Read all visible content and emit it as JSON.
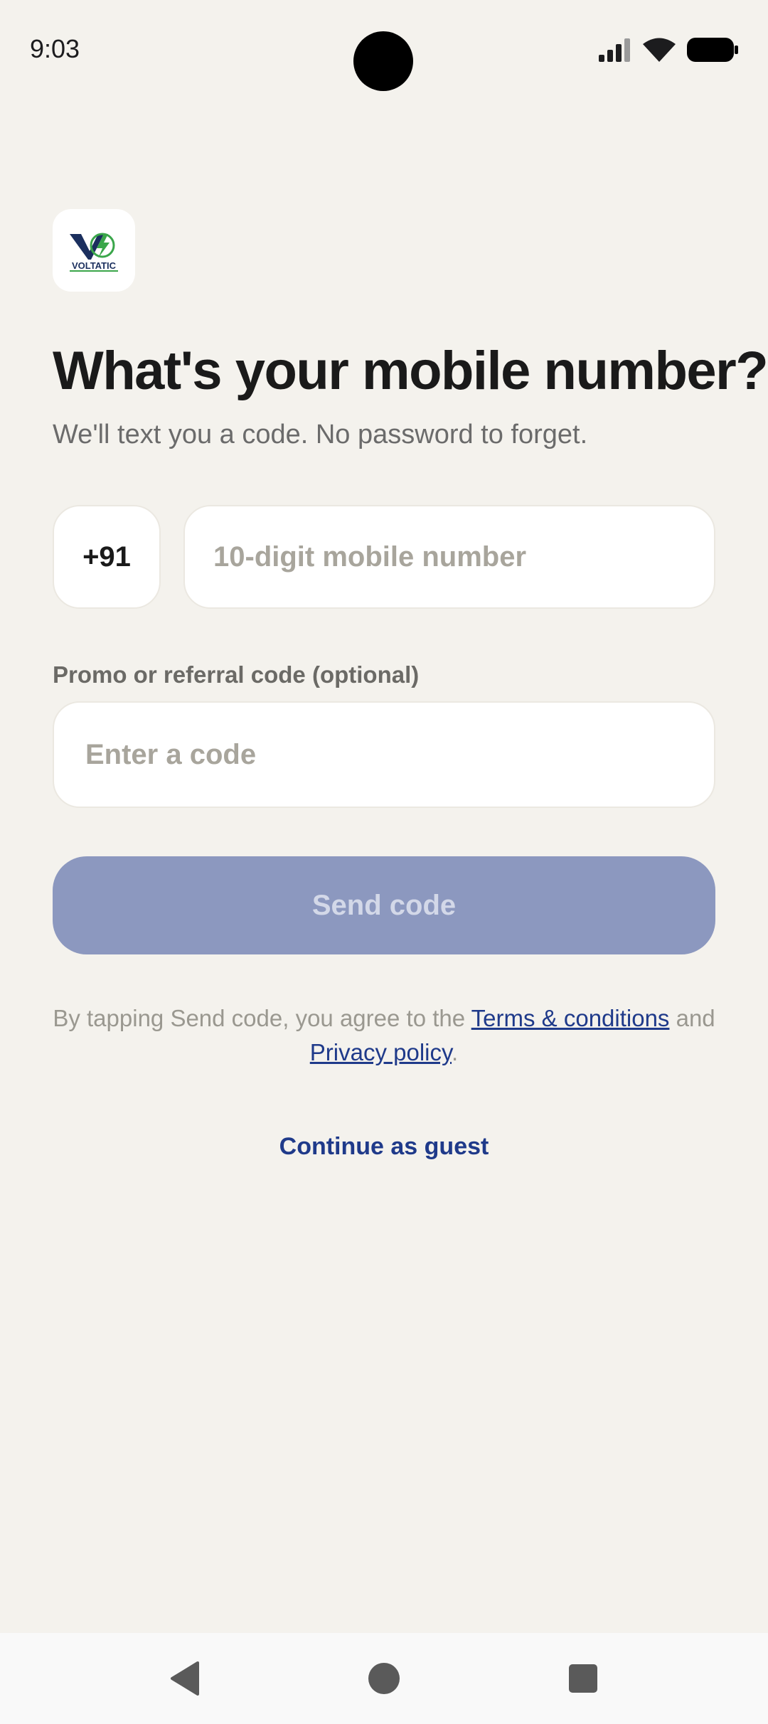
{
  "status_bar": {
    "time": "9:03",
    "icons": [
      "signal-icon",
      "wifi-icon",
      "battery-icon"
    ]
  },
  "logo": {
    "brand_text": "VOLTATIC",
    "icon": "voltatic-logo-icon"
  },
  "header": {
    "title": "What's your mobile number?",
    "subtitle": "We'll text you a code. No password to forget."
  },
  "phone": {
    "country_code": "+91",
    "placeholder": "10-digit mobile number",
    "value": ""
  },
  "promo": {
    "label": "Promo or referral code (optional)",
    "placeholder": "Enter a code",
    "value": ""
  },
  "send_button": {
    "label": "Send code",
    "enabled": false
  },
  "terms": {
    "prefix": "By tapping Send code, you agree to the ",
    "terms_link": "Terms & conditions",
    "middle": " and ",
    "privacy_link": "Privacy policy",
    "suffix": "."
  },
  "guest_link": "Continue as guest",
  "nav_bar": {
    "icons": [
      "back-icon",
      "home-icon",
      "recents-icon"
    ]
  },
  "colors": {
    "background": "#f4f2ed",
    "accent": "#1f3a8a",
    "button_disabled": "#8c98bf",
    "logo_green": "#3aa64a"
  }
}
